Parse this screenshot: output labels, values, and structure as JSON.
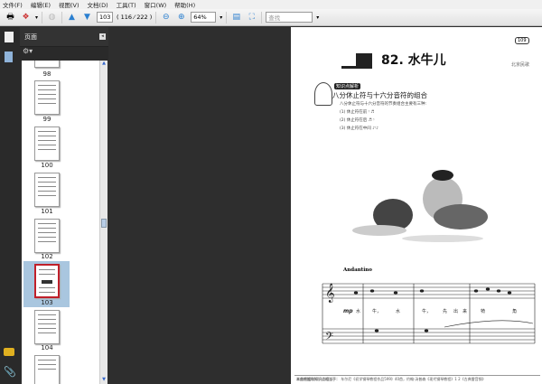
{
  "menu": [
    "文件(F)",
    "编辑(E)",
    "视图(V)",
    "文档(D)",
    "工具(T)",
    "窗口(W)",
    "帮助(H)"
  ],
  "toolbar": {
    "page_value": "103",
    "page_count": "( 116 ⁄ 222 )",
    "zoom": "64%",
    "search_placeholder": "查找"
  },
  "panel": {
    "title": "页面",
    "thumbnails": [
      {
        "label": "98"
      },
      {
        "label": "99"
      },
      {
        "label": "100"
      },
      {
        "label": "101"
      },
      {
        "label": "102"
      },
      {
        "label": "103",
        "selected": true
      },
      {
        "label": "104"
      }
    ]
  },
  "document": {
    "page_number": "109",
    "title": "82. 水牛儿",
    "region": "北京民歌",
    "badge": "知识点解析",
    "subtitle": "八分休止符与十六分音符的组合",
    "intro": "八分休止符与十六分音符的节奏组合主要有三种:",
    "items": [
      "(1) 休止符在前  𝄾 ♬",
      "(2) 休止符在后  ♬ 𝄾",
      "(3) 休止符在中间  ♪𝄾♪"
    ],
    "tempo": "Andantino",
    "dynamic": "mp",
    "lyrics": [
      "水",
      "牛，",
      "水",
      "牛，",
      "先",
      "出",
      "来",
      "犄",
      "角"
    ],
    "footer_label": "本曲根据和知识点相当于：",
    "footer_text": "车尔尼《初学钢琴教程作品599》40首，约翰·汤普森《现代钢琴教程》1 2《古典雷音钢》"
  },
  "colors": {
    "selection": "#a9c6df",
    "thumb_border": "#c0202a"
  }
}
